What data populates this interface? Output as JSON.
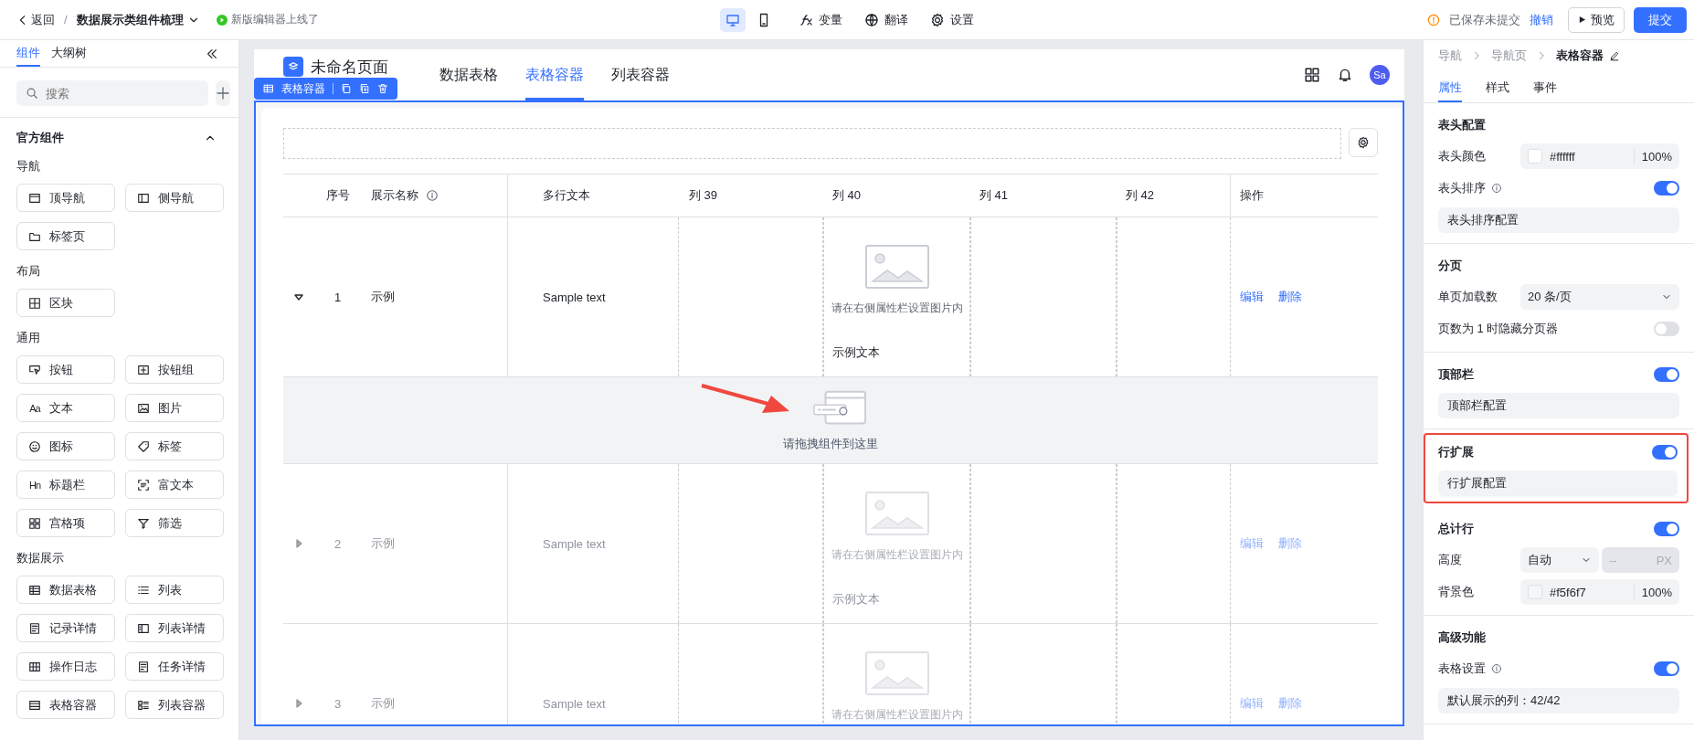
{
  "topbar": {
    "back": "返回",
    "separator": "/",
    "project": "数据展示类组件梳理",
    "notice": "新版编辑器上线了",
    "devices": [
      {
        "kind": "desktop",
        "selected": true
      },
      {
        "kind": "mobile",
        "selected": false
      }
    ],
    "tools": [
      {
        "kind": "variable",
        "label": "变量"
      },
      {
        "kind": "translate",
        "label": "翻译"
      },
      {
        "kind": "settings",
        "label": "设置"
      }
    ],
    "save_status": "已保存未提交",
    "undo": "撤销",
    "preview": "预览",
    "submit": "提交"
  },
  "left_panel": {
    "tabs": [
      {
        "label": "组件",
        "selected": true
      },
      {
        "label": "大纲树",
        "selected": false
      }
    ],
    "search": {
      "placeholder": "搜索"
    },
    "section": {
      "title": "官方组件",
      "expanded": true
    },
    "groups": [
      {
        "title": "导航",
        "items": [
          {
            "kind": "topnav",
            "label": "顶导航"
          },
          {
            "kind": "sidenav",
            "label": "侧导航"
          },
          {
            "kind": "tabs",
            "label": "标签页"
          }
        ]
      },
      {
        "title": "布局",
        "items": [
          {
            "kind": "block",
            "label": "区块"
          }
        ]
      },
      {
        "title": "通用",
        "items": [
          {
            "kind": "button",
            "label": "按钮"
          },
          {
            "kind": "buttongroup",
            "label": "按钮组"
          },
          {
            "kind": "text",
            "glyph": "Aa",
            "label": "文本"
          },
          {
            "kind": "image",
            "label": "图片"
          },
          {
            "kind": "icon",
            "label": "图标"
          },
          {
            "kind": "tag",
            "label": "标签"
          },
          {
            "kind": "title",
            "glyph": "Hn",
            "label": "标题栏"
          },
          {
            "kind": "richtext",
            "label": "富文本"
          },
          {
            "kind": "grid",
            "label": "宫格项"
          },
          {
            "kind": "filter",
            "label": "筛选"
          }
        ]
      },
      {
        "title": "数据展示",
        "items": [
          {
            "kind": "datatable",
            "label": "数据表格"
          },
          {
            "kind": "list",
            "label": "列表"
          },
          {
            "kind": "record",
            "label": "记录详情"
          },
          {
            "kind": "listdetail",
            "label": "列表详情"
          },
          {
            "kind": "log",
            "label": "操作日志"
          },
          {
            "kind": "task",
            "label": "任务详情"
          },
          {
            "kind": "tablecontainer",
            "label": "表格容器"
          },
          {
            "kind": "listcontainer",
            "label": "列表容器"
          }
        ]
      }
    ]
  },
  "canvas": {
    "page_title": "未命名页面",
    "nav_tabs": [
      {
        "label": "数据表格",
        "selected": false
      },
      {
        "label": "表格容器",
        "selected": true
      },
      {
        "label": "列表容器",
        "selected": false
      }
    ],
    "avatar": "Sa",
    "selection_label": "表格容器",
    "columns": [
      {
        "label": "序号",
        "info": false
      },
      {
        "label": "展示名称",
        "info": true
      },
      {
        "label": "多行文本",
        "info": false
      },
      {
        "label": "列 39",
        "info": false
      },
      {
        "label": "列 40",
        "info": false
      },
      {
        "label": "列 41",
        "info": false
      },
      {
        "label": "列 42",
        "info": false
      },
      {
        "label": "操作",
        "info": false
      }
    ],
    "rows": [
      {
        "expanded": true,
        "dimmed": false,
        "index": "1",
        "name": "示例",
        "text": "Sample text",
        "image_hint": "请在右侧属性栏设置图片内",
        "caption": "示例文本",
        "actions": [
          "编辑",
          "删除"
        ]
      },
      {
        "expanded": false,
        "dimmed": true,
        "index": "2",
        "name": "示例",
        "text": "Sample text",
        "image_hint": "请在右侧属性栏设置图片内",
        "caption": "示例文本",
        "actions": [
          "编辑",
          "删除"
        ]
      },
      {
        "expanded": false,
        "dimmed": true,
        "index": "3",
        "name": "示例",
        "text": "Sample text",
        "image_hint": "请在右侧属性栏设置图片内",
        "actions": [
          "编辑",
          "删除"
        ]
      }
    ],
    "drop_hint": "请拖拽组件到这里"
  },
  "right_panel": {
    "breadcrumb": [
      "导航",
      "导航页",
      "表格容器"
    ],
    "tabs": [
      {
        "label": "属性",
        "selected": true
      },
      {
        "label": "样式",
        "selected": false
      },
      {
        "label": "事件",
        "selected": false
      }
    ],
    "sections": [
      {
        "title": "表头配置",
        "highlighted": false,
        "rows": [
          {
            "kind": "color",
            "label": "表头颜色",
            "color": "#ffffff",
            "value": "#ffffff",
            "opacity": "100%"
          },
          {
            "kind": "toggle",
            "label": "表头排序",
            "info": true,
            "on": true
          },
          {
            "kind": "config",
            "label": "表头排序配置"
          }
        ]
      },
      {
        "title": "分页",
        "highlighted": false,
        "rows": [
          {
            "kind": "select",
            "label": "单页加载数",
            "value": "20 条/页"
          },
          {
            "kind": "toggle",
            "label": "页数为 1 时隐藏分页器",
            "info": false,
            "on": false
          }
        ]
      },
      {
        "title": "顶部栏",
        "on": true,
        "highlighted": false,
        "rows": [
          {
            "kind": "config",
            "label": "顶部栏配置"
          }
        ]
      },
      {
        "title": "行扩展",
        "on": true,
        "highlighted": true,
        "rows": [
          {
            "kind": "config",
            "label": "行扩展配置"
          }
        ]
      },
      {
        "title": "总计行",
        "on": true,
        "highlighted": false,
        "rows": [
          {
            "kind": "size",
            "label": "高度",
            "value": "自动",
            "placeholder": "--",
            "unit": "PX"
          },
          {
            "kind": "color",
            "label": "背景色",
            "color": "#f5f6f7",
            "value": "#f5f6f7",
            "opacity": "100%"
          }
        ]
      },
      {
        "title": "高级功能",
        "highlighted": false,
        "rows": [
          {
            "kind": "toggle",
            "label": "表格设置",
            "info": true,
            "on": true
          },
          {
            "kind": "config",
            "label": "默认展示的列：42/42"
          }
        ]
      }
    ]
  }
}
